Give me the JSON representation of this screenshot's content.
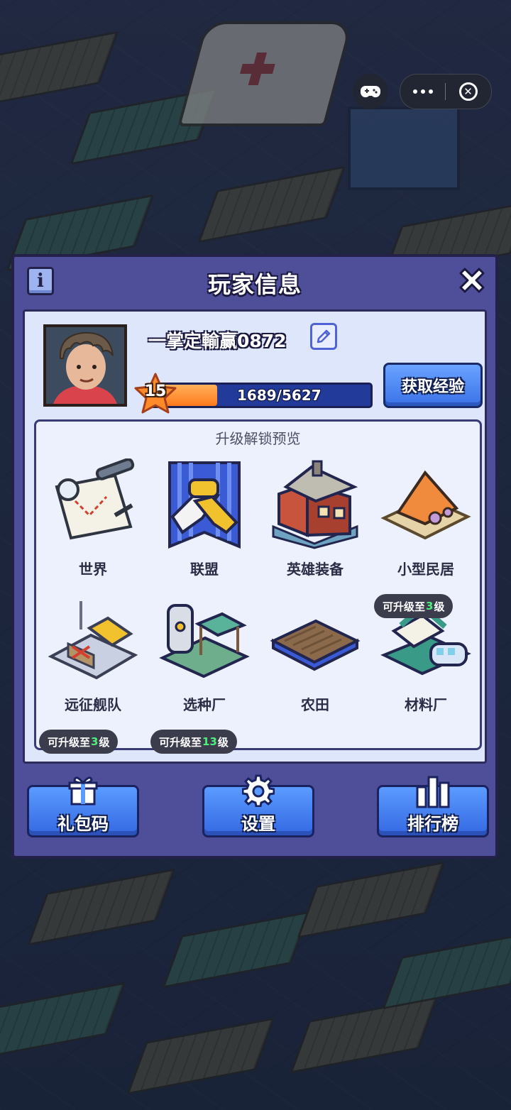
{
  "panel": {
    "title": "玩家信息",
    "info_icon": "info-icon",
    "close_icon": "close-icon"
  },
  "player": {
    "name": "一掌定輸赢0872",
    "level": "15",
    "xp_text": "1689/5627",
    "xp_fraction": 0.3,
    "get_exp_label": "获取经验"
  },
  "preview": {
    "title": "升级解锁预览",
    "items": [
      {
        "label": "世界",
        "icon": "world-map-icon"
      },
      {
        "label": "联盟",
        "icon": "alliance-icon"
      },
      {
        "label": "英雄装备",
        "icon": "hero-equipment-icon"
      },
      {
        "label": "小型民居",
        "icon": "small-house-icon"
      },
      {
        "label": "远征舰队",
        "icon": "expedition-fleet-icon"
      },
      {
        "label": "选种厂",
        "icon": "seed-factory-icon"
      },
      {
        "label": "农田",
        "icon": "farmland-icon"
      },
      {
        "label": "材料厂",
        "icon": "material-factory-icon"
      }
    ],
    "badges": {
      "material_prefix": "可升级至",
      "material_level": "3",
      "material_suffix": "级",
      "row3a_prefix": "可升级至",
      "row3a_level": "3",
      "row3a_suffix": "级",
      "row3b_prefix": "可升级至",
      "row3b_level": "13",
      "row3b_suffix": "级"
    }
  },
  "bottom": {
    "gift_code": "礼包码",
    "settings": "设置",
    "leaderboard": "排行榜"
  },
  "colors": {
    "panel": "#4f4f99",
    "inner": "#dde6fb",
    "button_blue": "#3a72e8",
    "xp_orange": "#ff7a1c",
    "level_green": "#4cf07a"
  }
}
